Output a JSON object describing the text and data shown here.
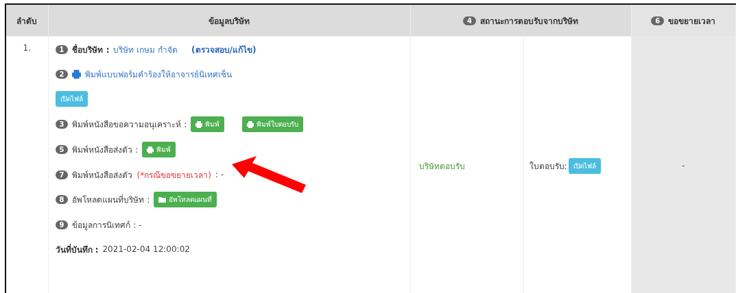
{
  "table": {
    "columns": [
      {
        "label": "ลำดับ"
      },
      {
        "label": "ข้อมูลบริษัท"
      },
      {
        "badge": "4",
        "label": "สถานะการตอบรับจากบริษัท"
      },
      {
        "badge": "6",
        "label": "ขอขยายเวลา"
      }
    ],
    "rows": [
      {
        "number": "1.",
        "items": [
          {
            "badge": "1",
            "parts": [
              {
                "kind": "label",
                "text": "ชื่อบริษัท :"
              },
              {
                "kind": "link",
                "text": "บริษัท เกษม กำจัด"
              },
              {
                "kind": "edit-link",
                "text": "(ตรวจสอบ/แก้ไข)"
              }
            ]
          },
          {
            "badge": "2",
            "parts": [
              {
                "kind": "print-link",
                "text": "พิมพ์แบบฟอร์มคำร้องให้อาจารย์นิเทศเซ็น"
              }
            ]
          },
          {
            "parts": [
              {
                "kind": "open-button",
                "text": "เปิดไฟล์"
              }
            ]
          },
          {
            "badge": "3",
            "parts": [
              {
                "kind": "text",
                "text": "พิมพ์หนังสือขอความอนุเคราะห์ :"
              },
              {
                "kind": "print-button",
                "text": "พิมพ์"
              },
              {
                "kind": "print-button",
                "text": "พิมพ์ใบตอบรับ"
              }
            ]
          },
          {
            "badge": "5",
            "parts": [
              {
                "kind": "text",
                "text": "พิมพ์หนังสือส่งตัว :"
              },
              {
                "kind": "print-button",
                "text": "พิมพ์"
              }
            ]
          },
          {
            "badge": "7",
            "parts": [
              {
                "kind": "text",
                "text": "พิมพ์หนังสือส่งตัว"
              },
              {
                "kind": "note",
                "text": "(*กรณีขอขยายเวลา)"
              },
              {
                "kind": "text",
                "text": ": -"
              }
            ]
          },
          {
            "badge": "8",
            "parts": [
              {
                "kind": "text",
                "text": "อัพโหลดแผนที่บริษัท :"
              },
              {
                "kind": "upload-button",
                "text": "อัพโหลดแผนที่"
              }
            ]
          },
          {
            "badge": "9",
            "parts": [
              {
                "kind": "text",
                "text": "ข้อมูลการนิเทศก์ : -"
              }
            ]
          },
          {
            "parts": [
              {
                "kind": "label",
                "text": "วันที่บันทึก :"
              },
              {
                "kind": "text",
                "text": "2021-02-04 12:00:02"
              }
            ]
          }
        ],
        "status": "บริษัทตอบรับ",
        "reply_label": "ใบตอบรับ:",
        "reply_button": "เปิดไฟล์",
        "extension": "-"
      }
    ]
  }
}
